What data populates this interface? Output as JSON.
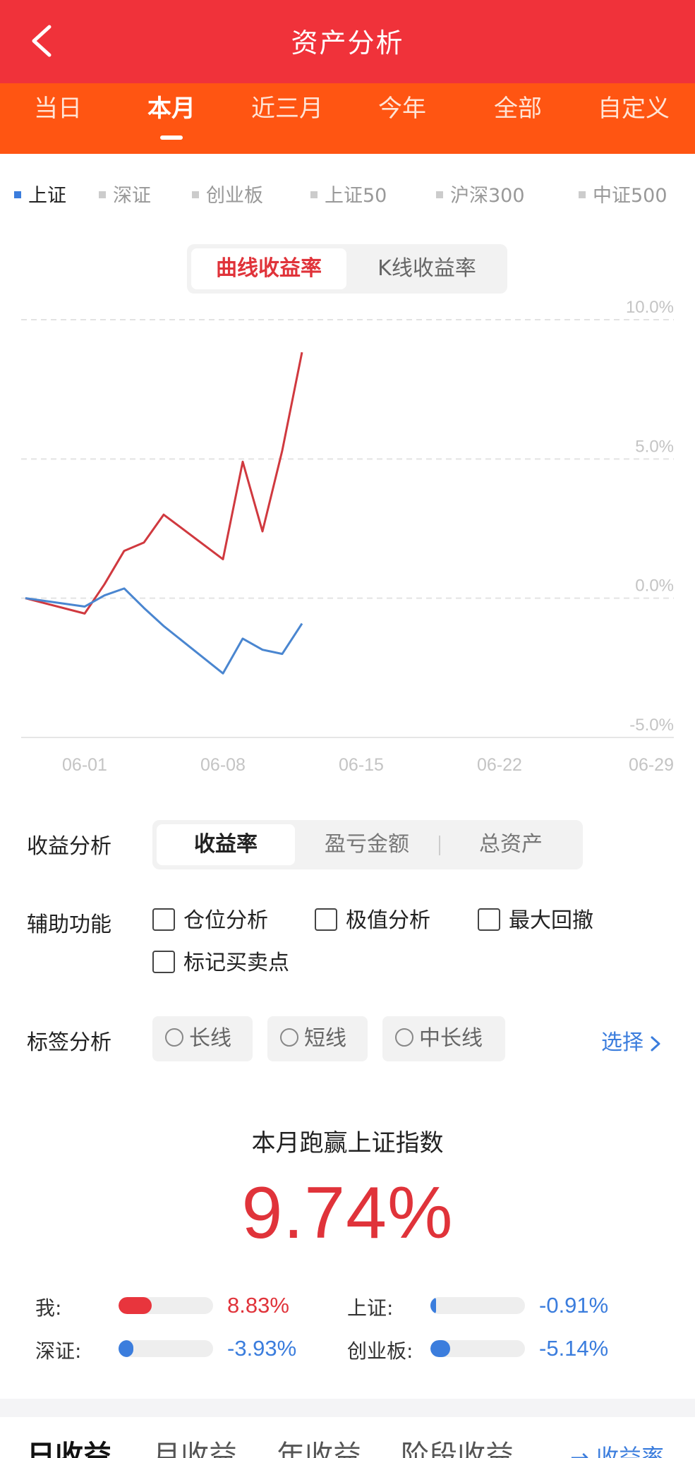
{
  "header": {
    "title": "资产分析",
    "back_icon": "chevron-left-icon"
  },
  "periods": [
    {
      "label": "当日",
      "active": false
    },
    {
      "label": "本月",
      "active": true
    },
    {
      "label": "近三月",
      "active": false
    },
    {
      "label": "今年",
      "active": false
    },
    {
      "label": "全部",
      "active": false
    },
    {
      "label": "自定义",
      "active": false
    }
  ],
  "indices": [
    {
      "label": "上证",
      "active": true
    },
    {
      "label": "深证",
      "active": false
    },
    {
      "label": "创业板",
      "active": false
    },
    {
      "label": "上证50",
      "active": false
    },
    {
      "label": "沪深300",
      "active": false
    },
    {
      "label": "中证500",
      "active": false
    }
  ],
  "chart_mode": {
    "active": "曲线收益率",
    "inactive": "K线收益率"
  },
  "chart_data": {
    "type": "line",
    "y_ticks": [
      "10.0%",
      "5.0%",
      "0.0%",
      "-5.0%"
    ],
    "x_ticks": [
      "06-01",
      "06-08",
      "06-15",
      "06-22",
      "06-29"
    ],
    "ylim": [
      -5,
      10
    ],
    "grid": true,
    "series": [
      {
        "color": "#d0393f",
        "points": [
          [
            -2,
            0
          ],
          [
            1,
            -0.55
          ],
          [
            2,
            0.5
          ],
          [
            3,
            1.7
          ],
          [
            4,
            2.0
          ],
          [
            5,
            3.0
          ],
          [
            8,
            1.4
          ],
          [
            9,
            4.9
          ],
          [
            10,
            2.4
          ],
          [
            11,
            5.3
          ],
          [
            12,
            8.83
          ]
        ]
      },
      {
        "color": "#4a86d0",
        "points": [
          [
            -2,
            0
          ],
          [
            1,
            -0.3
          ],
          [
            2,
            0.1
          ],
          [
            3,
            0.35
          ],
          [
            4,
            -0.35
          ],
          [
            5,
            -1.0
          ],
          [
            8,
            -2.7
          ],
          [
            9,
            -1.45
          ],
          [
            10,
            -1.85
          ],
          [
            11,
            -2.0
          ],
          [
            12,
            -0.91
          ]
        ]
      }
    ]
  },
  "income_analysis": {
    "label": "收益分析",
    "options": [
      "收益率",
      "盈亏金额",
      "总资产"
    ],
    "active_index": 0
  },
  "aux": {
    "label": "辅助功能",
    "options": [
      "仓位分析",
      "极值分析",
      "最大回撤",
      "标记买卖点"
    ]
  },
  "tags": {
    "label": "标签分析",
    "options": [
      "长线",
      "短线",
      "中长线"
    ],
    "select": "选择"
  },
  "result": {
    "title": "本月跑赢上证指数",
    "value": "9.74%"
  },
  "comparison": [
    {
      "label": "我:",
      "value": "8.83%",
      "fraction": 0.35,
      "color": "#e8353d"
    },
    {
      "label": "上证:",
      "value": "-0.91%",
      "fraction": 0.06,
      "color": "#3b7ddd"
    },
    {
      "label": "深证:",
      "value": "-3.93%",
      "fraction": 0.16,
      "color": "#3b7ddd"
    },
    {
      "label": "创业板:",
      "value": "-5.14%",
      "fraction": 0.21,
      "color": "#3b7ddd"
    }
  ],
  "bottom_tabs": [
    "日收益",
    "月收益",
    "年收益",
    "阶段收益"
  ],
  "bottom_right": "→ 收益率"
}
